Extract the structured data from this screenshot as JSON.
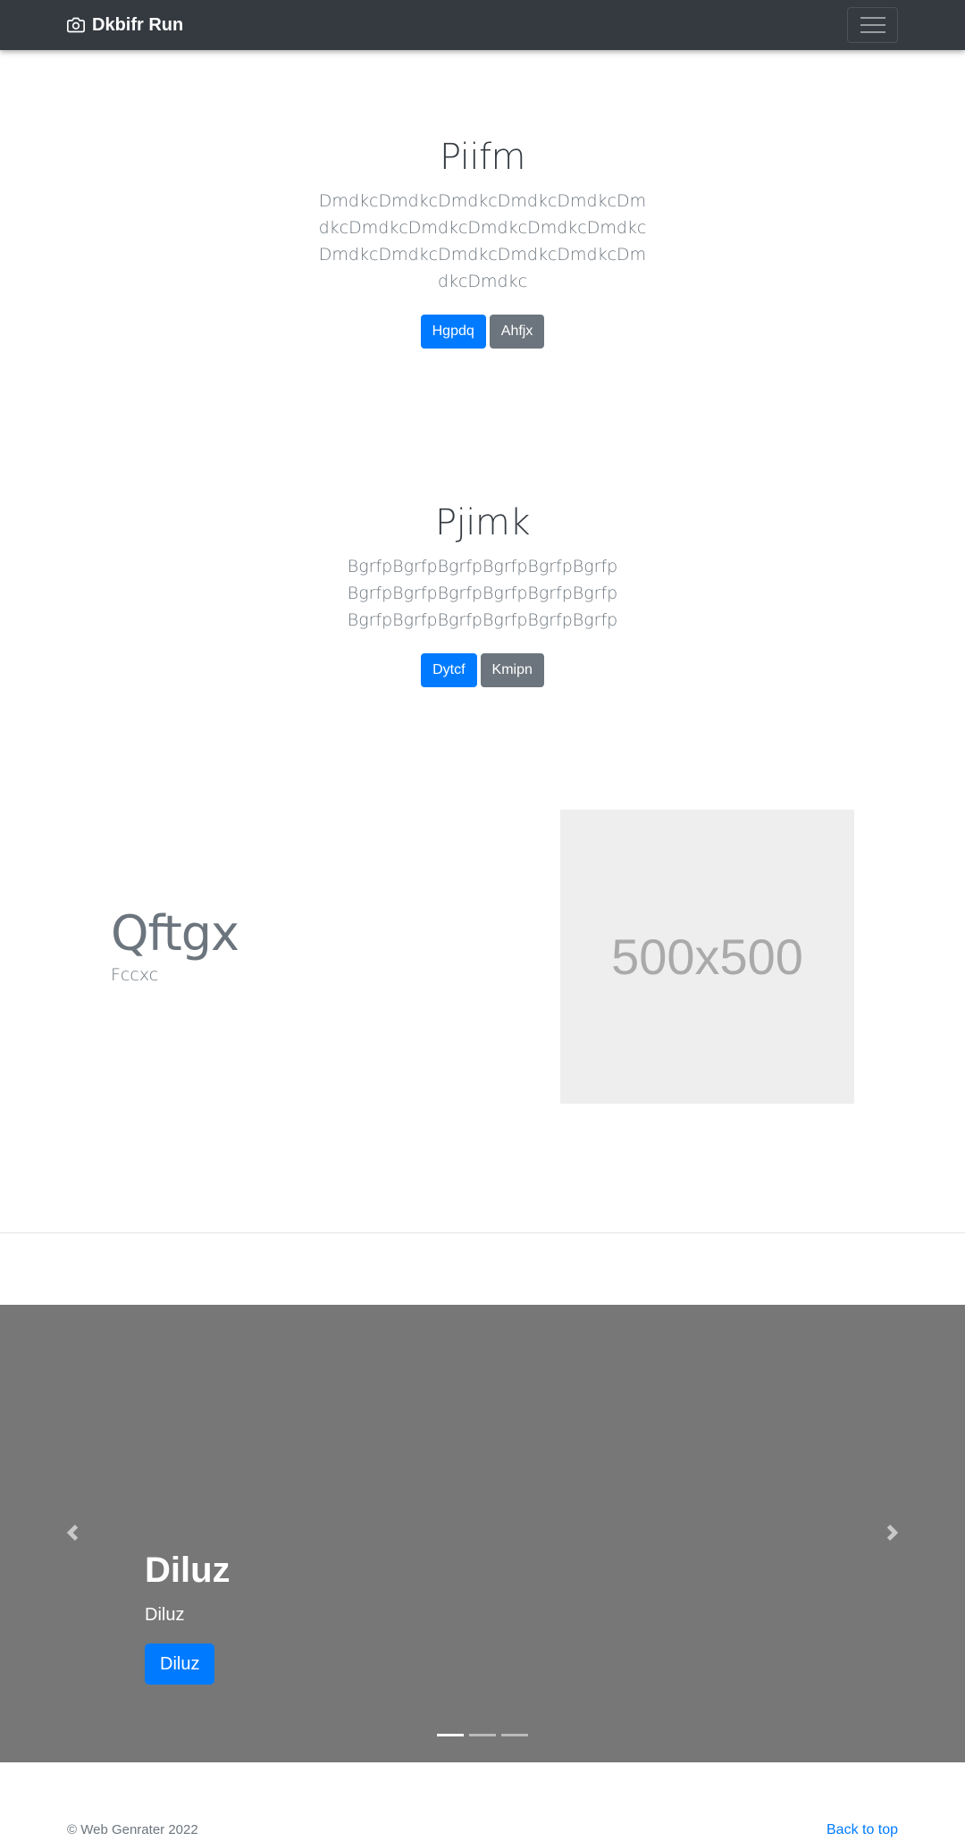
{
  "navbar": {
    "brand": "Dkbifr Run",
    "brand_icon": "camera-icon",
    "toggler_icon": "hamburger-icon"
  },
  "hero1": {
    "title": "Piifm",
    "lead": "DmdkcDmdkcDmdkcDmdkcDmdkcDmdkcDmdkcDmdkcDmdkcDmdkcDmdkcDmdkcDmdkcDmdkcDmdkcDmdkcDmdkcDmdkc",
    "primary_label": "Hgpdq",
    "secondary_label": "Ahfjx"
  },
  "hero2": {
    "title": "Pjimk",
    "lead": "BgrfpBgrfpBgrfpBgrfpBgrfpBgrfp BgrfpBgrfpBgrfpBgrfpBgrfpBgrfp BgrfpBgrfpBgrfpBgrfpBgrfpBgrfp",
    "primary_label": "Dytcf",
    "secondary_label": "Kmipn"
  },
  "feature": {
    "heading": "Qftgx",
    "subtext": "Fccxc",
    "image_label": "500x500"
  },
  "carousel": {
    "caption_title": "Diluz",
    "caption_text": "Diluz",
    "caption_button": "Diluz",
    "prev_icon": "chevron-left-icon",
    "next_icon": "chevron-right-icon",
    "slide_count": 3,
    "active_slide": 1
  },
  "footer": {
    "copyright": "© Web Genrater 2022",
    "back_to_top": "Back to top"
  },
  "colors": {
    "navbar_bg": "#343a40",
    "primary": "#007bff",
    "secondary": "#6c757d",
    "carousel_bg": "#777777",
    "placeholder_bg": "#eeeeee"
  }
}
